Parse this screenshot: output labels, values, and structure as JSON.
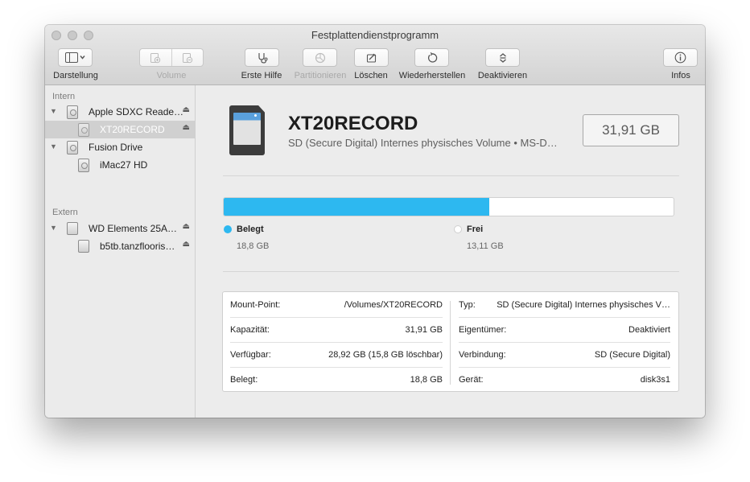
{
  "window": {
    "title": "Festplattendienstprogramm"
  },
  "toolbar": {
    "view_label": "Darstellung",
    "volume_label": "Volume",
    "first_aid_label": "Erste Hilfe",
    "partition_label": "Partitionieren",
    "erase_label": "Löschen",
    "restore_label": "Wiederherstellen",
    "unmount_label": "Deaktivieren",
    "info_label": "Infos"
  },
  "sidebar": {
    "internal_header": "Intern",
    "external_header": "Extern",
    "items": [
      {
        "label": "Apple SDXC Reade…",
        "level": 0,
        "ejectable": true
      },
      {
        "label": "XT20RECORD",
        "level": 1,
        "selected": true,
        "ejectable": true
      },
      {
        "label": "Fusion Drive",
        "level": 0,
        "ejectable": false
      },
      {
        "label": "iMac27 HD",
        "level": 1,
        "ejectable": false
      },
      {
        "label": "WD Elements 25A…",
        "level": 0,
        "ejectable": true
      },
      {
        "label": "b5tb.tanzflooris…",
        "level": 1,
        "ejectable": true
      }
    ]
  },
  "volume": {
    "name": "XT20RECORD",
    "description": "SD (Secure Digital) Internes physisches Volume • MS-D…",
    "capacity_display": "31,91 GB"
  },
  "usage": {
    "used_fraction": 0.59,
    "used_color": "#2db8f0",
    "free_color": "#ffffff",
    "used_title": "Belegt",
    "used_value": "18,8 GB",
    "free_title": "Frei",
    "free_value": "13,11 GB"
  },
  "info": {
    "left": [
      {
        "key": "Mount-Point:",
        "value": "/Volumes/XT20RECORD"
      },
      {
        "key": "Kapazität:",
        "value": "31,91 GB"
      },
      {
        "key": "Verfügbar:",
        "value": "28,92 GB (15,8 GB löschbar)"
      },
      {
        "key": "Belegt:",
        "value": "18,8 GB"
      }
    ],
    "right": [
      {
        "key": "Typ:",
        "value": "SD (Secure Digital) Internes physisches V…"
      },
      {
        "key": "Eigentümer:",
        "value": "Deaktiviert"
      },
      {
        "key": "Verbindung:",
        "value": "SD (Secure Digital)"
      },
      {
        "key": "Gerät:",
        "value": "disk3s1"
      }
    ]
  }
}
